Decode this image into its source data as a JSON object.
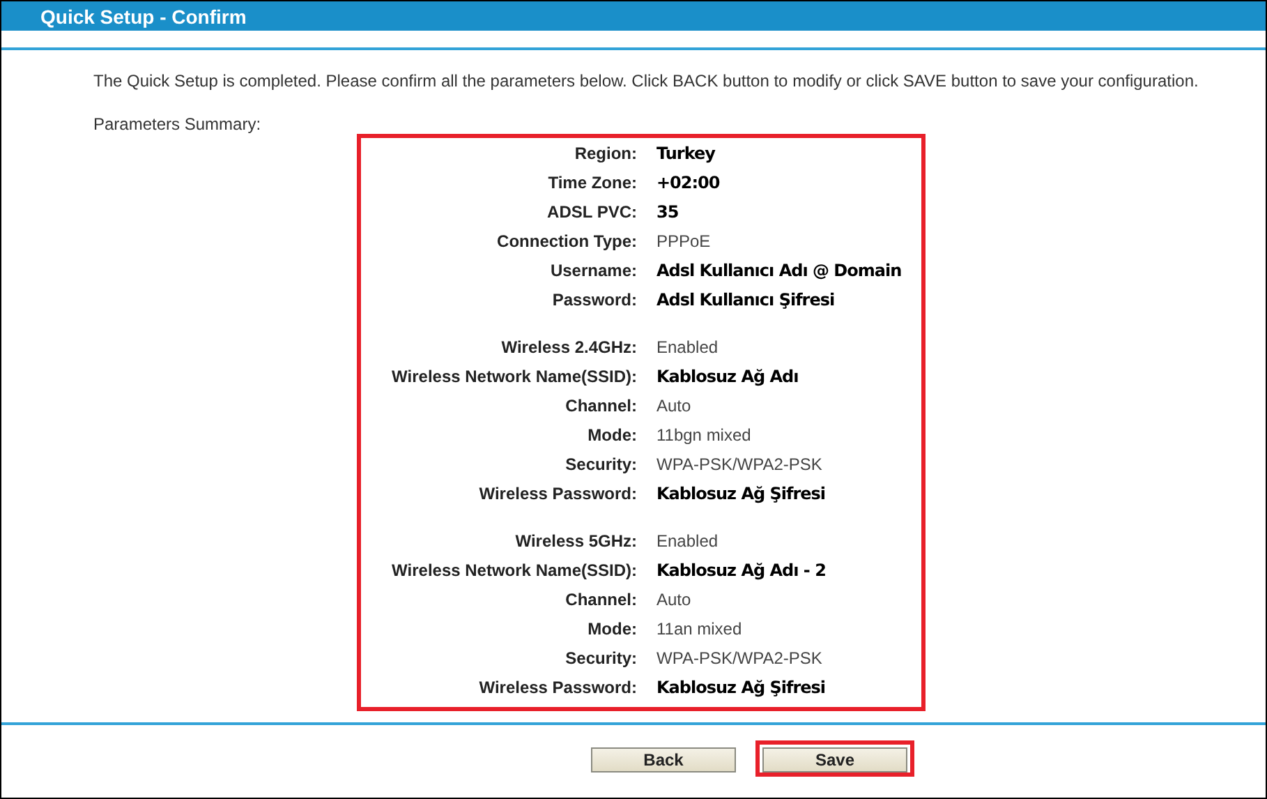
{
  "window": {
    "title": "Quick Setup - Confirm"
  },
  "intro": "The Quick Setup is completed. Please confirm all the parameters below. Click BACK button to modify or click SAVE button to save your configuration.",
  "summary_label": "Parameters Summary:",
  "summary": {
    "highlighted": true,
    "groups": [
      [
        {
          "label": "Region:",
          "value": "Turkey",
          "emphasized": true
        },
        {
          "label": "Time Zone:",
          "value": "+02:00",
          "emphasized": true
        },
        {
          "label": "ADSL PVC:",
          "value": "35",
          "emphasized": true
        },
        {
          "label": "Connection Type:",
          "value": "PPPoE",
          "emphasized": false
        },
        {
          "label": "Username:",
          "value": "Adsl Kullanıcı Adı @ Domain",
          "emphasized": true
        },
        {
          "label": "Password:",
          "value": "Adsl Kullanıcı Şifresi",
          "emphasized": true
        }
      ],
      [
        {
          "label": "Wireless 2.4GHz:",
          "value": "Enabled",
          "emphasized": false
        },
        {
          "label": "Wireless Network Name(SSID):",
          "value": "Kablosuz Ağ Adı",
          "emphasized": true
        },
        {
          "label": "Channel:",
          "value": "Auto",
          "emphasized": false
        },
        {
          "label": "Mode:",
          "value": "11bgn mixed",
          "emphasized": false
        },
        {
          "label": "Security:",
          "value": "WPA-PSK/WPA2-PSK",
          "emphasized": false
        },
        {
          "label": "Wireless Password:",
          "value": "Kablosuz Ağ Şifresi",
          "emphasized": true
        }
      ],
      [
        {
          "label": "Wireless 5GHz:",
          "value": "Enabled",
          "emphasized": false
        },
        {
          "label": "Wireless Network Name(SSID):",
          "value": "Kablosuz Ağ Adı - 2",
          "emphasized": true
        },
        {
          "label": "Channel:",
          "value": "Auto",
          "emphasized": false
        },
        {
          "label": "Mode:",
          "value": "11an mixed",
          "emphasized": false
        },
        {
          "label": "Security:",
          "value": "WPA-PSK/WPA2-PSK",
          "emphasized": false
        },
        {
          "label": "Wireless Password:",
          "value": "Kablosuz Ağ Şifresi",
          "emphasized": true
        }
      ]
    ]
  },
  "buttons": [
    {
      "label": "Back",
      "highlighted": false
    },
    {
      "label": "Save",
      "highlighted": true
    }
  ]
}
